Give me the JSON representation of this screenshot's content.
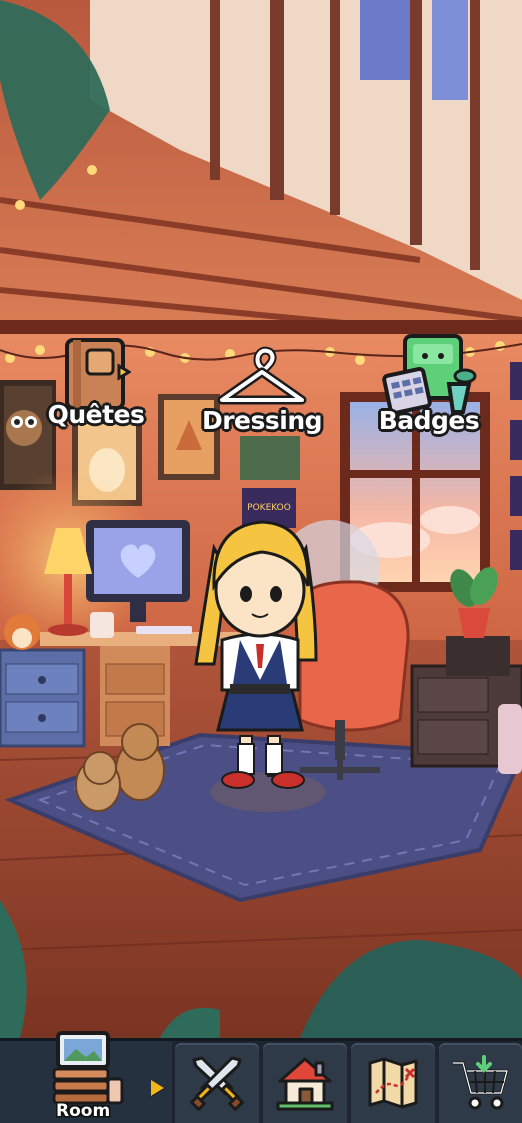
{
  "hud": {
    "quests_label": "Quêtes",
    "dressing_label": "Dressing",
    "badges_label": "Badges"
  },
  "poster_text": "POKEKOO",
  "navbar": {
    "room_label": "Room",
    "items": [
      {
        "icon": "room-furniture-icon"
      },
      {
        "icon": "crossed-swords-icon"
      },
      {
        "icon": "house-icon"
      },
      {
        "icon": "treasure-map-icon"
      },
      {
        "icon": "shopping-cart-icon"
      }
    ]
  },
  "colors": {
    "navbar_bg": "#1d2530",
    "nav_cell": "#2f3a48",
    "arrow": "#f2b619",
    "rug": "#4b4f86",
    "wall": "#d9724f"
  }
}
